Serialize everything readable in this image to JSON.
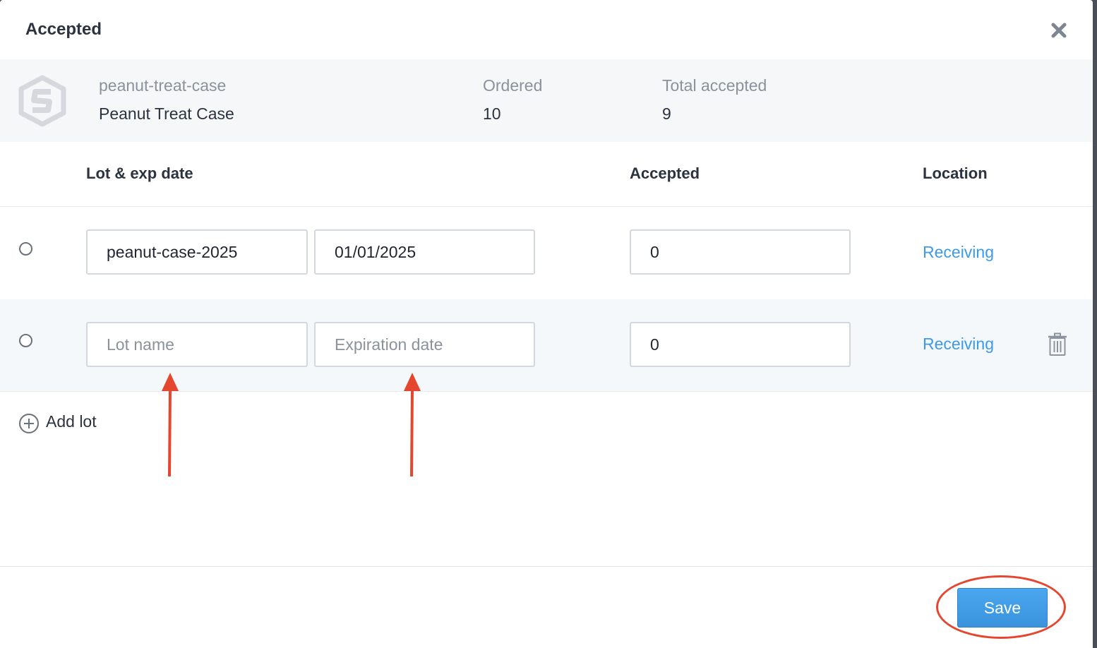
{
  "modal": {
    "title": "Accepted"
  },
  "product": {
    "sku": "peanut-treat-case",
    "name": "Peanut Treat Case",
    "ordered_label": "Ordered",
    "ordered_value": "10",
    "total_accepted_label": "Total accepted",
    "total_accepted_value": "9"
  },
  "table": {
    "headers": {
      "lot": "Lot & exp date",
      "accepted": "Accepted",
      "location": "Location"
    },
    "rows": [
      {
        "lot_name": "peanut-case-2025",
        "exp_date": "01/01/2025",
        "accepted": "0",
        "location": "Receiving"
      },
      {
        "lot_name": "",
        "lot_placeholder": "Lot name",
        "exp_date": "",
        "exp_placeholder": "Expiration date",
        "accepted": "0",
        "location": "Receiving"
      }
    ]
  },
  "actions": {
    "add_lot_label": "Add lot",
    "save_label": "Save"
  },
  "annotations": {
    "arrow_color": "#e5462f",
    "circle_color": "#e5462f"
  },
  "colors": {
    "link": "#3d9ae8",
    "primary_button": "#3a92dd"
  }
}
